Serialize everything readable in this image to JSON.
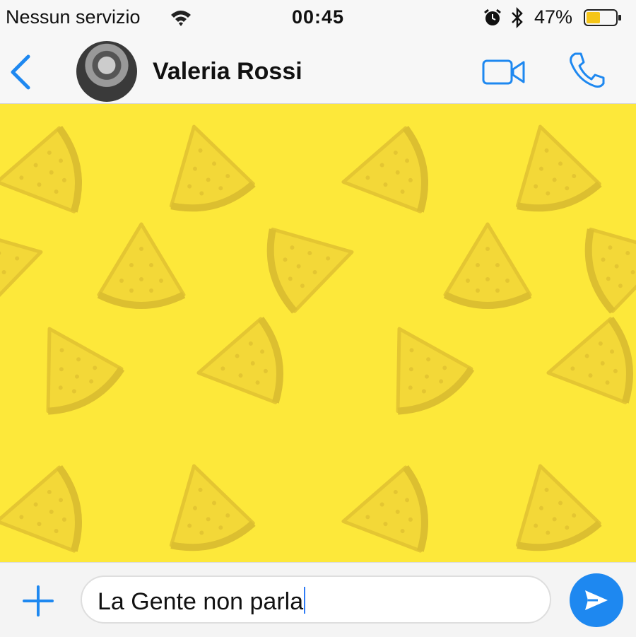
{
  "status_bar": {
    "carrier": "Nessun servizio",
    "time": "00:45",
    "battery": "47%",
    "icons": [
      "wifi-icon",
      "alarm-icon",
      "bluetooth-icon",
      "battery-icon"
    ]
  },
  "header": {
    "contact_name": "Valeria Rossi",
    "actions": [
      "back-icon",
      "video-call-icon",
      "phone-icon"
    ]
  },
  "chat": {
    "wallpaper": "watermelon-slice-pattern",
    "wallpaper_color": "#fde83a"
  },
  "composer": {
    "text": "La Gente non parla",
    "buttons": [
      "plus-icon",
      "send-icon"
    ]
  },
  "colors": {
    "accent": "#1e88f0",
    "chat_background": "#fde83a"
  }
}
